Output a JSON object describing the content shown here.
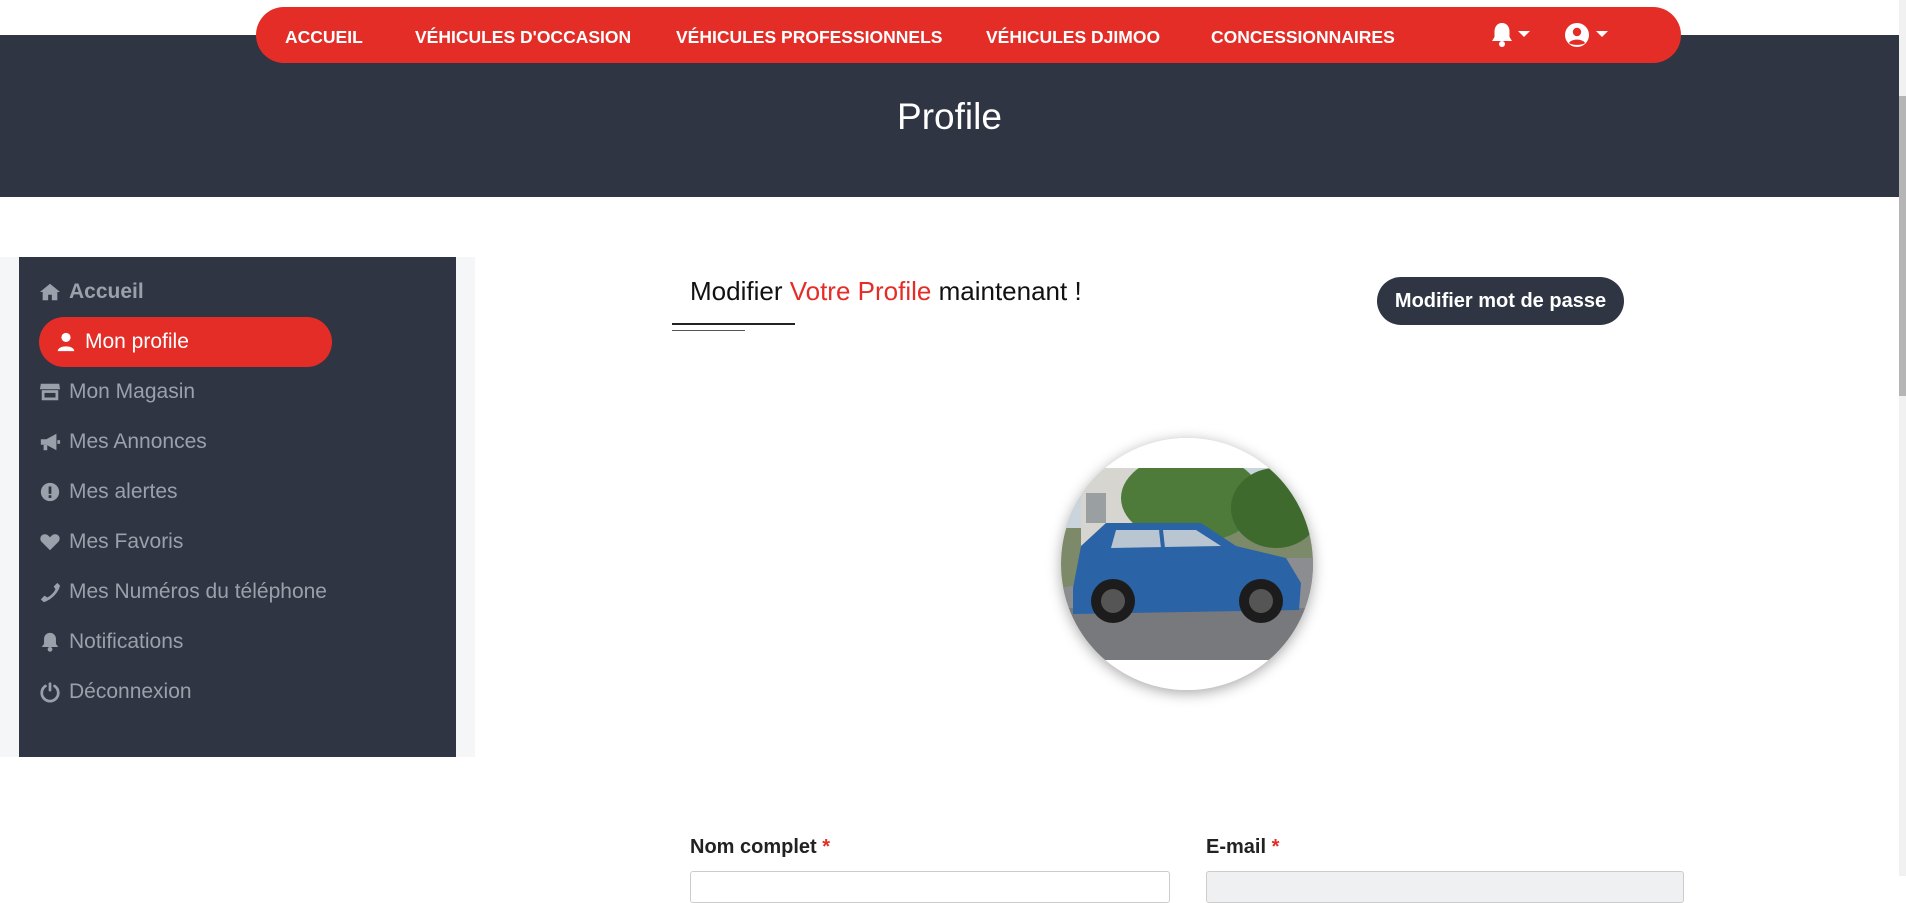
{
  "nav": {
    "links": [
      "ACCUEIL",
      "VÉHICULES D'OCCASION",
      "VÉHICULES PROFESSIONNELS",
      "VÉHICULES DJIMOO",
      "CONCESSIONNAIRES"
    ],
    "icons": [
      "bell-icon",
      "user-circle-icon"
    ]
  },
  "hero": {
    "title": "Profile"
  },
  "sidebar": {
    "items": [
      {
        "label": "Accueil",
        "icon": "home-icon",
        "bold": true
      },
      {
        "label": "Mon profile",
        "icon": "user-icon",
        "active": true
      },
      {
        "label": "Mon Magasin",
        "icon": "store-icon"
      },
      {
        "label": "Mes Annonces",
        "icon": "megaphone-icon"
      },
      {
        "label": "Mes alertes",
        "icon": "exclamation-circle-icon"
      },
      {
        "label": "Mes Favoris",
        "icon": "heart-icon"
      },
      {
        "label": "Mes Numéros du téléphone",
        "icon": "phone-icon"
      },
      {
        "label": "Notifications",
        "icon": "bell-icon"
      },
      {
        "label": "Déconnexion",
        "icon": "power-icon"
      }
    ]
  },
  "main": {
    "heading_part1": "Modifier",
    "heading_accent": "Votre Profile",
    "heading_part2": "maintenant !",
    "password_button": "Modifier mot de passe",
    "form": {
      "fullname_label": "Nom complet",
      "email_label": "E-mail",
      "required_mark": "*"
    }
  },
  "colors": {
    "brand": "#e52d27",
    "dark": "#2f3542",
    "muted": "#9aa1ab"
  }
}
